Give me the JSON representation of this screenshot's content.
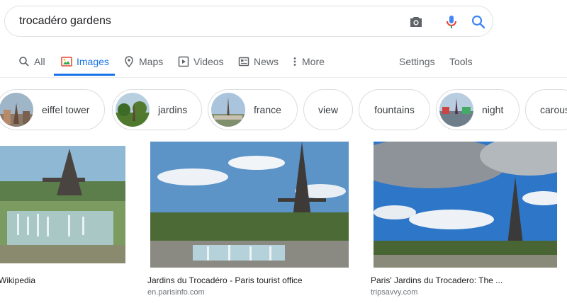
{
  "search": {
    "query": "trocadéro gardens",
    "icons": [
      "camera-icon",
      "microphone-icon",
      "search-icon"
    ]
  },
  "tabs": [
    {
      "label": "All",
      "icon": "search-icon",
      "active": false
    },
    {
      "label": "Images",
      "icon": "images-icon",
      "active": true
    },
    {
      "label": "Maps",
      "icon": "map-pin-icon",
      "active": false
    },
    {
      "label": "Videos",
      "icon": "video-play-icon",
      "active": false
    },
    {
      "label": "News",
      "icon": "news-icon",
      "active": false
    },
    {
      "label": "More",
      "icon": "more-vert-icon",
      "active": false
    }
  ],
  "tools": {
    "settings": "Settings",
    "tools": "Tools"
  },
  "chips": [
    {
      "label": "eiffel tower"
    },
    {
      "label": "jardins"
    },
    {
      "label": "france"
    },
    {
      "label": "view"
    },
    {
      "label": "fountains"
    },
    {
      "label": "night"
    },
    {
      "label": "carous"
    }
  ],
  "results": [
    {
      "title": "Wikipedia",
      "source": ""
    },
    {
      "title": "Jardins du Trocadéro - Paris tourist office",
      "source": "en.parisinfo.com"
    },
    {
      "title": "Paris' Jardins du Trocadero: The ...",
      "source": "tripsavvy.com"
    }
  ],
  "colors": {
    "accent": "#1a73e8",
    "muted": "#5f6368",
    "border": "#dfe1e5"
  }
}
